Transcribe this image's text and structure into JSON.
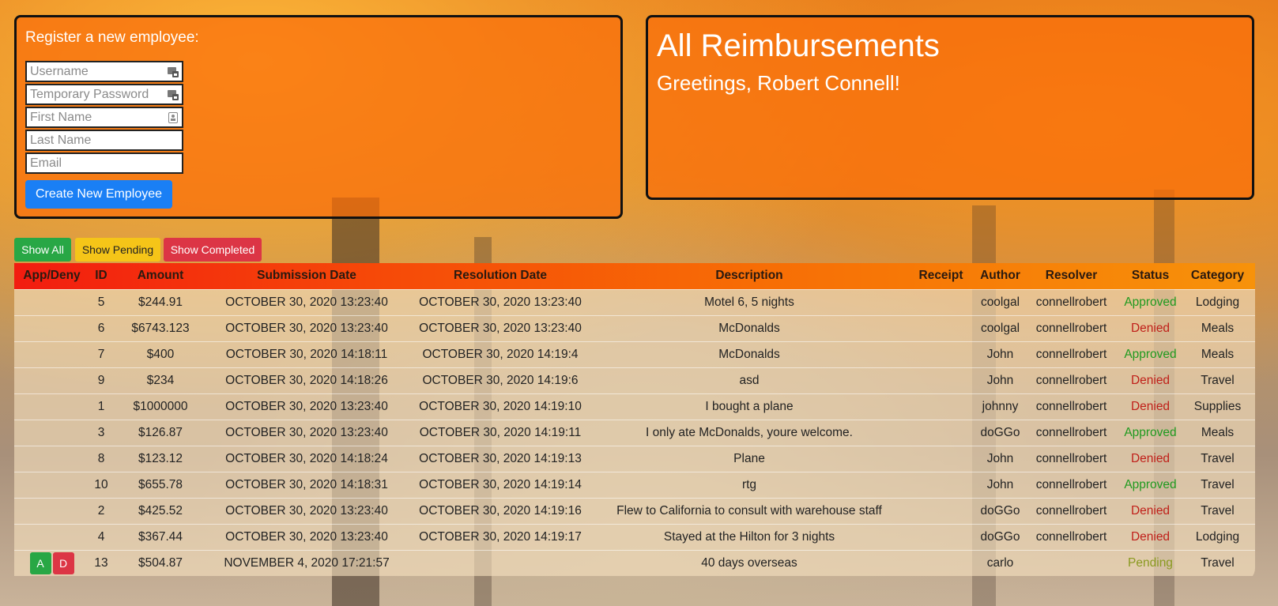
{
  "register": {
    "title": "Register a new employee:",
    "username_placeholder": "Username",
    "password_placeholder": "Temporary Password",
    "firstname_placeholder": "First Name",
    "lastname_placeholder": "Last Name",
    "email_placeholder": "Email",
    "create_label": "Create New Employee"
  },
  "header": {
    "title": "All Reimbursements",
    "greeting": "Greetings, Robert Connell!"
  },
  "filters": {
    "all": "Show All",
    "pending": "Show Pending",
    "completed": "Show Completed"
  },
  "table": {
    "columns": [
      "App/Deny",
      "ID",
      "Amount",
      "Submission Date",
      "Resolution Date",
      "Description",
      "Receipt",
      "Author",
      "Resolver",
      "Status",
      "Category"
    ],
    "rows": [
      {
        "id": "5",
        "amount": "$244.91",
        "submitted": "OCTOBER 30, 2020 13:23:40",
        "resolved": "OCTOBER 30, 2020 13:23:40",
        "description": "Motel 6, 5 nights",
        "receipt": "",
        "author": "coolgal",
        "resolver": "connellrobert",
        "status": "Approved",
        "category": "Lodging"
      },
      {
        "id": "6",
        "amount": "$6743.123",
        "submitted": "OCTOBER 30, 2020 13:23:40",
        "resolved": "OCTOBER 30, 2020 13:23:40",
        "description": "McDonalds",
        "receipt": "",
        "author": "coolgal",
        "resolver": "connellrobert",
        "status": "Denied",
        "category": "Meals"
      },
      {
        "id": "7",
        "amount": "$400",
        "submitted": "OCTOBER 30, 2020 14:18:11",
        "resolved": "OCTOBER 30, 2020 14:19:4",
        "description": "McDonalds",
        "receipt": "",
        "author": "John",
        "resolver": "connellrobert",
        "status": "Approved",
        "category": "Meals"
      },
      {
        "id": "9",
        "amount": "$234",
        "submitted": "OCTOBER 30, 2020 14:18:26",
        "resolved": "OCTOBER 30, 2020 14:19:6",
        "description": "asd",
        "receipt": "",
        "author": "John",
        "resolver": "connellrobert",
        "status": "Denied",
        "category": "Travel"
      },
      {
        "id": "1",
        "amount": "$1000000",
        "submitted": "OCTOBER 30, 2020 13:23:40",
        "resolved": "OCTOBER 30, 2020 14:19:10",
        "description": "I bought a plane",
        "receipt": "",
        "author": "johnny",
        "resolver": "connellrobert",
        "status": "Denied",
        "category": "Supplies"
      },
      {
        "id": "3",
        "amount": "$126.87",
        "submitted": "OCTOBER 30, 2020 13:23:40",
        "resolved": "OCTOBER 30, 2020 14:19:11",
        "description": "I only ate McDonalds, youre welcome.",
        "receipt": "",
        "author": "doGGo",
        "resolver": "connellrobert",
        "status": "Approved",
        "category": "Meals"
      },
      {
        "id": "8",
        "amount": "$123.12",
        "submitted": "OCTOBER 30, 2020 14:18:24",
        "resolved": "OCTOBER 30, 2020 14:19:13",
        "description": "Plane",
        "receipt": "",
        "author": "John",
        "resolver": "connellrobert",
        "status": "Denied",
        "category": "Travel"
      },
      {
        "id": "10",
        "amount": "$655.78",
        "submitted": "OCTOBER 30, 2020 14:18:31",
        "resolved": "OCTOBER 30, 2020 14:19:14",
        "description": "rtg",
        "receipt": "",
        "author": "John",
        "resolver": "connellrobert",
        "status": "Approved",
        "category": "Travel"
      },
      {
        "id": "2",
        "amount": "$425.52",
        "submitted": "OCTOBER 30, 2020 13:23:40",
        "resolved": "OCTOBER 30, 2020 14:19:16",
        "description": "Flew to California to consult with warehouse staff",
        "receipt": "",
        "author": "doGGo",
        "resolver": "connellrobert",
        "status": "Denied",
        "category": "Travel"
      },
      {
        "id": "4",
        "amount": "$367.44",
        "submitted": "OCTOBER 30, 2020 13:23:40",
        "resolved": "OCTOBER 30, 2020 14:19:17",
        "description": "Stayed at the Hilton for 3 nights",
        "receipt": "",
        "author": "doGGo",
        "resolver": "connellrobert",
        "status": "Denied",
        "category": "Lodging"
      },
      {
        "id": "13",
        "amount": "$504.87",
        "submitted": "NOVEMBER 4, 2020 17:21:57",
        "resolved": "",
        "description": "40 days overseas",
        "receipt": "",
        "author": "carlo",
        "resolver": "",
        "status": "Pending",
        "category": "Travel",
        "actions": {
          "approve": "A",
          "deny": "D"
        }
      }
    ]
  },
  "colors": {
    "approved": "#1f9a1f",
    "denied": "#c0201a",
    "pending": "#8a9a20",
    "primary": "#1a7ff5"
  }
}
